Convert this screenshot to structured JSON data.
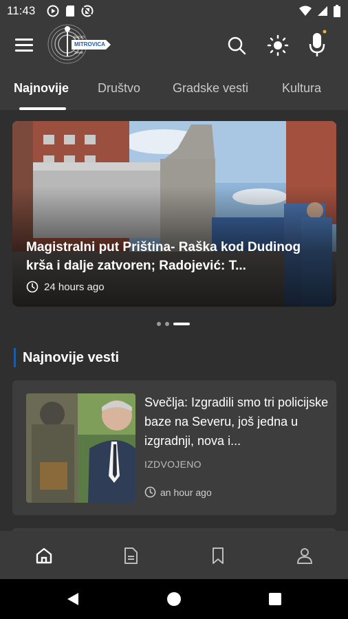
{
  "status_bar": {
    "time": "11:43",
    "left_icons": [
      "play-circle-icon",
      "sd-card-icon",
      "no-sim-icon"
    ],
    "right_icons": [
      "wifi-icon",
      "signal-icon",
      "battery-icon"
    ]
  },
  "app_bar": {
    "logo_text": {
      "top": "RADIO",
      "main": "MITROVICA",
      "sub": "Sever"
    },
    "icons": [
      "menu-icon",
      "search-icon",
      "brightness-icon",
      "microphone-icon"
    ]
  },
  "tabs": [
    {
      "label": "Najnovije",
      "active": true
    },
    {
      "label": "Društvo",
      "active": false
    },
    {
      "label": "Gradske vesti",
      "active": false
    },
    {
      "label": "Kultura",
      "active": false
    }
  ],
  "hero": {
    "title": "Magistralni put Priština- Raška kod Dudinog krša i dalje zatvoren; Radojević: T...",
    "time": "24 hours ago",
    "carousel_count": 3,
    "carousel_active": 3
  },
  "section": {
    "title": "Najnovije vesti"
  },
  "article": {
    "title": "Svečlja: Izgradili smo tri policijske baze na Severu, još jedna u izgradnji, nova i...",
    "category": "IZDVOJENO",
    "time": "an hour ago"
  },
  "bottom_nav": [
    "home-icon",
    "document-icon",
    "bookmark-icon",
    "profile-icon"
  ],
  "system_nav": [
    "back-icon",
    "home-circle-icon",
    "recents-icon"
  ],
  "colors": {
    "background": "#2f2f2f",
    "bar": "#3a3a3a",
    "card": "#3d3d3d",
    "accent": "#1e5aa8"
  }
}
